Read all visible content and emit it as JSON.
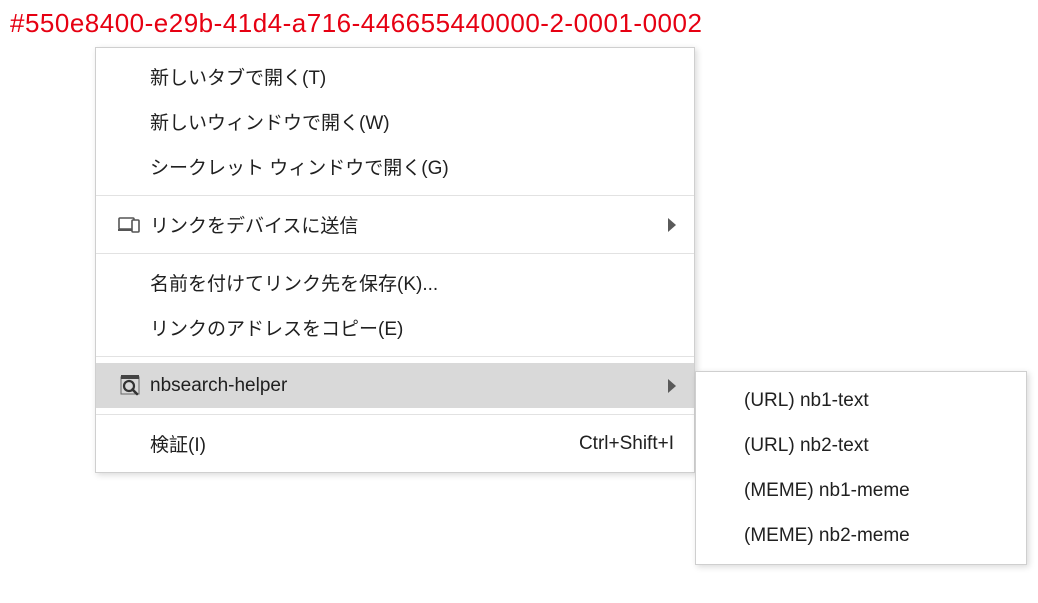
{
  "link_text": "#550e8400-e29b-41d4-a716-446655440000-2-0001-0002",
  "menu": {
    "open_new_tab": "新しいタブで開く(T)",
    "open_new_window": "新しいウィンドウで開く(W)",
    "open_incognito": "シークレット ウィンドウで開く(G)",
    "send_to_device": "リンクをデバイスに送信",
    "save_link_as": "名前を付けてリンク先を保存(K)...",
    "copy_link_address": "リンクのアドレスをコピー(E)",
    "nbsearch_helper": "nbsearch-helper",
    "inspect": "検証(I)",
    "inspect_shortcut": "Ctrl+Shift+I"
  },
  "submenu": {
    "items": [
      "(URL) nb1-text",
      "(URL) nb2-text",
      "(MEME) nb1-meme",
      "(MEME) nb2-meme"
    ]
  }
}
